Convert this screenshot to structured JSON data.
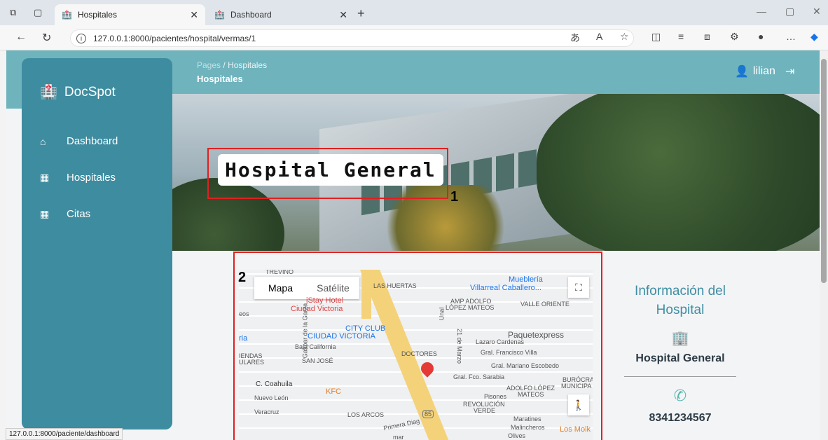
{
  "browser": {
    "tabs": [
      {
        "label": "Hospitales"
      },
      {
        "label": "Dashboard"
      }
    ],
    "new_tab": "+",
    "url": "127.0.0.1:8000/pacientes/hospital/vermas/1",
    "status_url": "127.0.0.1:8000/paciente/dashboard"
  },
  "sidebar": {
    "brand": "DocSpot",
    "items": [
      {
        "label": "Dashboard",
        "icon": "home-icon"
      },
      {
        "label": "Hospitales",
        "icon": "hospital-icon"
      },
      {
        "label": "Citas",
        "icon": "hospital-icon"
      }
    ]
  },
  "header": {
    "breadcrumb_root": "Pages",
    "breadcrumb_sep": "/",
    "breadcrumb_current": "Hospitales",
    "title": "Hospitales",
    "user": "lilian"
  },
  "hero": {
    "title": "Hospital General",
    "annotation": "1"
  },
  "map": {
    "annotation": "2",
    "tab_map": "Mapa",
    "tab_sat": "Satélite",
    "labels": {
      "trevino": "TREVINO",
      "las_huertas": "LAS HUERTAS",
      "muebleria": "Mueblería",
      "villarreal": "Villarreal Caballero...",
      "istay": "iStay Hotel",
      "ciudad_victoria": "Ciudad Victoria",
      "amp": "AMP ADOLFO",
      "lopez_mateos": "LÓPEZ MATEOS",
      "valle_oriente": "VALLE ORIENTE",
      "eos": "eos",
      "city_club": "CITY CLUB",
      "ciudad_victoria2": "CIUDAD VICTORIA",
      "paquetexpress": "Paquetexpress",
      "lazaro": "Lazaro Cardenas",
      "francisco": "Gral. Francisco Villa",
      "ria": "ria",
      "baja": "Baja California",
      "doctores": "DOCTORES",
      "jendas": "IENDAS",
      "ulares": "ULARES",
      "san_jose": "SAN JOSÉ",
      "escobedo": "Gral. Mariano Escobedo",
      "sarabia": "Gral. Fco. Sarabia",
      "burocrat": "BURÓCRAT",
      "municipa": "MUNICIPA",
      "coahuila": "C. Coahuila",
      "kfc": "KFC",
      "adolfo_lopez": "ADOLFO LÓPEZ",
      "mateos": "MATEOS",
      "nuevo_leon": "Nuevo León",
      "pisones": "Pisones",
      "revolucion": "REVOLUCIÓN",
      "verde": "VERDE",
      "veracruz": "Veracruz",
      "los_arcos": "LOS ARCOS",
      "primera": "Primera Diag",
      "marz": "21 de Marzo",
      "maratines": "Maratines",
      "malincheros": "Malincheros",
      "olives": "Olives",
      "los_molk": "Los Molk",
      "ruta": "85",
      "gaspar": "Gaspar de la Garza",
      "unal": "Unal",
      "mar": "mar"
    }
  },
  "info": {
    "title": "Información del Hospital",
    "hospital_name": "Hospital General",
    "phone": "8341234567"
  }
}
